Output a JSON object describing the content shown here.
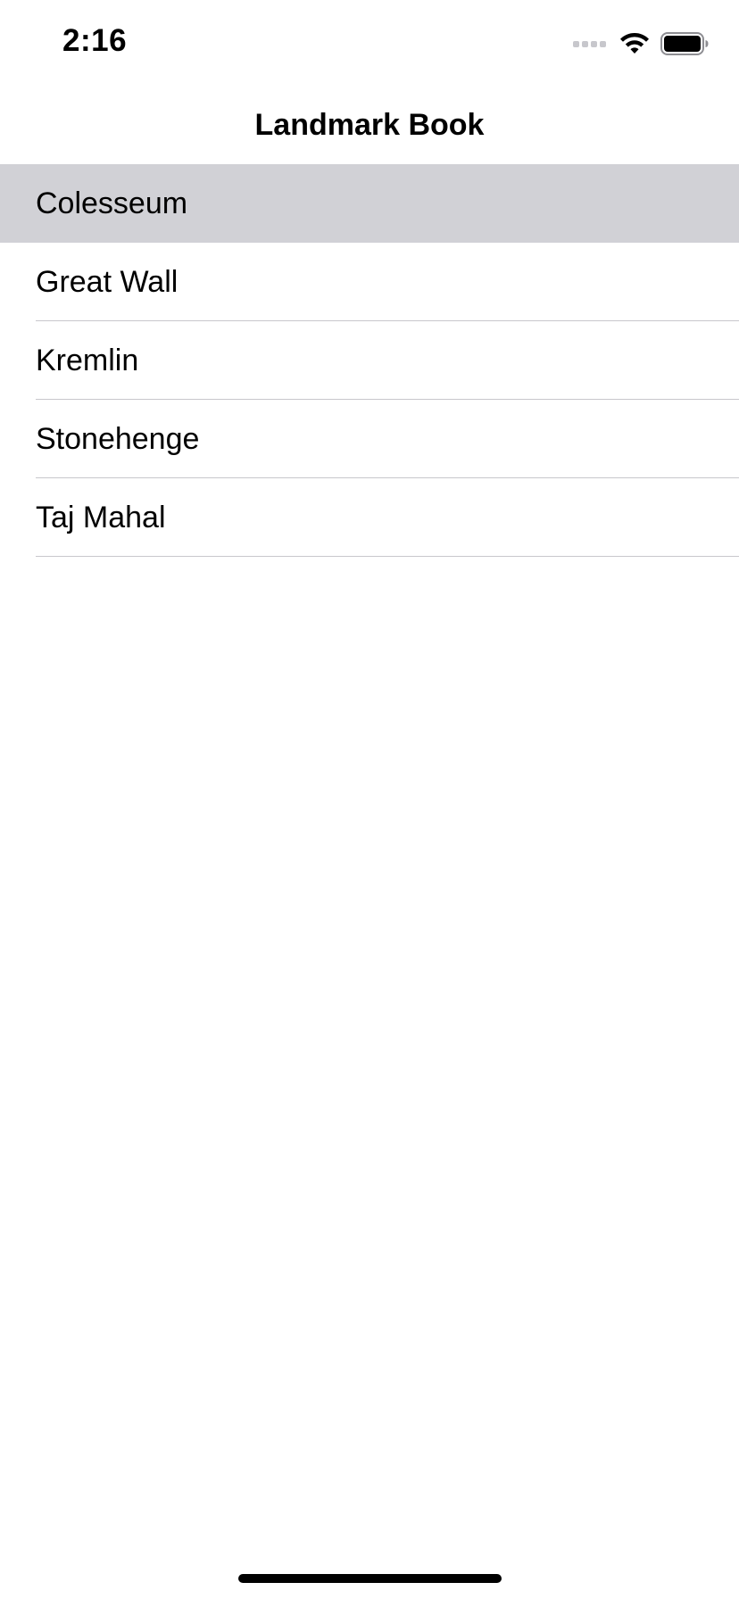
{
  "status_bar": {
    "time": "2:16",
    "signal_icon": "cellular-signal-icon",
    "wifi_icon": "wifi-icon",
    "battery_icon": "battery-icon"
  },
  "nav": {
    "title": "Landmark Book"
  },
  "list": {
    "items": [
      {
        "label": "Colesseum",
        "selected": true
      },
      {
        "label": "Great Wall",
        "selected": false
      },
      {
        "label": "Kremlin",
        "selected": false
      },
      {
        "label": "Stonehenge",
        "selected": false
      },
      {
        "label": "Taj Mahal",
        "selected": false
      }
    ]
  },
  "colors": {
    "background": "#ffffff",
    "selected_row": "#d1d1d6",
    "separator": "#c8c7cc",
    "text": "#000000"
  }
}
